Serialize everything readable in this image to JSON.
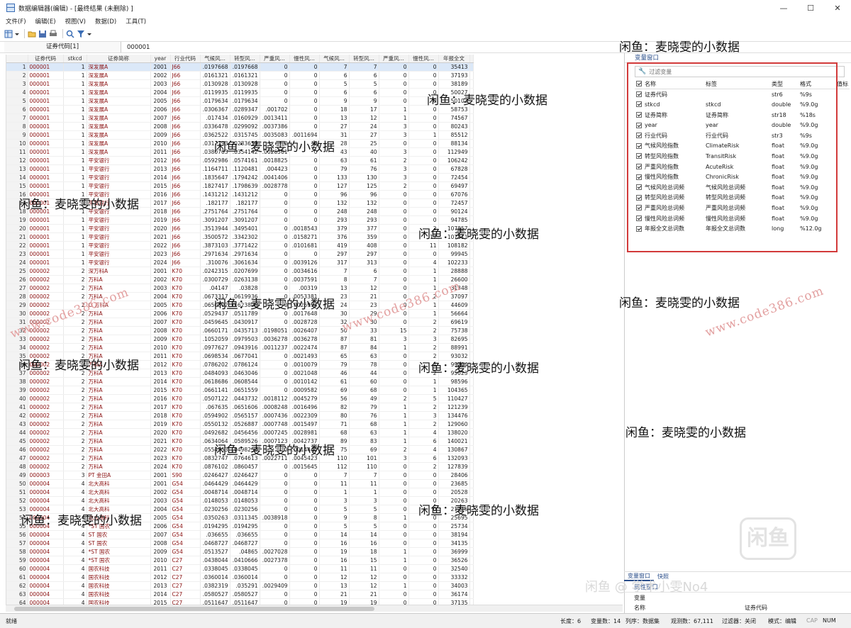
{
  "window": {
    "title": "数据编辑器(编辑) - [最终结果 (未删除) ]",
    "controls": [
      "—",
      "☐",
      "✕"
    ]
  },
  "menu": [
    "文件(F)",
    "编辑(E)",
    "视图(V)",
    "数据(D)",
    "工具(T)"
  ],
  "cmdbar": {
    "var_label": "证券代码[1]",
    "value": "000001"
  },
  "columns": [
    "证券代码",
    "stkcd",
    "证券简称",
    "year",
    "行业代码",
    "气候风...",
    "转型风...",
    "严重风...",
    "慢性风...",
    "气候风...",
    "转型风...",
    "严重风...",
    "慢性风...",
    "年报全文"
  ],
  "rows": [
    [
      "000001",
      "1",
      "深发展A",
      "2001",
      "J66",
      ".0197668",
      ".0197668",
      "0",
      "0",
      "7",
      "7",
      "0",
      "0",
      "35413"
    ],
    [
      "000001",
      "1",
      "深发展A",
      "2002",
      "J66",
      ".0161321",
      ".0161321",
      "0",
      "0",
      "6",
      "6",
      "0",
      "0",
      "37193"
    ],
    [
      "000001",
      "1",
      "深发展A",
      "2003",
      "J66",
      ".0130928",
      ".0130928",
      "0",
      "0",
      "5",
      "5",
      "0",
      "0",
      "38189"
    ],
    [
      "000001",
      "1",
      "深发展A",
      "2004",
      "J66",
      ".0119935",
      ".0119935",
      "0",
      "0",
      "6",
      "6",
      "0",
      "0",
      "50027"
    ],
    [
      "000001",
      "1",
      "深发展A",
      "2005",
      "J66",
      ".0179634",
      ".0179634",
      "0",
      "0",
      "9",
      "9",
      "0",
      "0",
      "50102"
    ],
    [
      "000001",
      "1",
      "深发展A",
      "2006",
      "J66",
      ".0306367",
      ".0289347",
      ".001702",
      "0",
      "18",
      "17",
      "1",
      "0",
      "58753"
    ],
    [
      "000001",
      "1",
      "深发展A",
      "2007",
      "J66",
      ".017434",
      ".0160929",
      ".0013411",
      "0",
      "13",
      "12",
      "1",
      "0",
      "74567"
    ],
    [
      "000001",
      "1",
      "深发展A",
      "2008",
      "J66",
      ".0336478",
      ".0299092",
      ".0037386",
      "0",
      "27",
      "24",
      "3",
      "0",
      "80243"
    ],
    [
      "000001",
      "1",
      "深发展A",
      "2009",
      "J66",
      ".0362522",
      ".0315745",
      ".0035083",
      ".0011694",
      "31",
      "27",
      "3",
      "1",
      "85512"
    ],
    [
      "000001",
      "1",
      "深发展A",
      "2010",
      "J66",
      ".0317793",
      ".0283659",
      "0",
      "0",
      "28",
      "25",
      "0",
      "0",
      "88134"
    ],
    [
      "000001",
      "1",
      "深发展A",
      "2011",
      "J66",
      ".0380703",
      ".0354142",
      ".0026561",
      "0",
      "43",
      "40",
      "3",
      "0",
      "112949"
    ],
    [
      "000001",
      "1",
      "平安银行",
      "2012",
      "J66",
      ".0592986",
      ".0574161",
      ".0018825",
      "0",
      "63",
      "61",
      "2",
      "0",
      "106242"
    ],
    [
      "000001",
      "1",
      "平安银行",
      "2013",
      "J66",
      ".1164711",
      ".1120481",
      ".004423",
      "0",
      "79",
      "76",
      "3",
      "0",
      "67828"
    ],
    [
      "000001",
      "1",
      "平安银行",
      "2014",
      "J66",
      ".1835647",
      ".1794242",
      ".0041406",
      "0",
      "133",
      "130",
      "3",
      "0",
      "72454"
    ],
    [
      "000001",
      "1",
      "平安银行",
      "2015",
      "J66",
      ".1827417",
      ".1798639",
      ".0028778",
      "0",
      "127",
      "125",
      "2",
      "0",
      "69497"
    ],
    [
      "000001",
      "1",
      "平安银行",
      "2016",
      "J66",
      ".1431212",
      ".1431212",
      "0",
      "0",
      "96",
      "96",
      "0",
      "0",
      "67076"
    ],
    [
      "000001",
      "1",
      "平安银行",
      "2017",
      "J66",
      ".182177",
      ".182177",
      "0",
      "0",
      "132",
      "132",
      "0",
      "0",
      "72457"
    ],
    [
      "000001",
      "1",
      "平安银行",
      "2018",
      "J66",
      ".2751764",
      ".2751764",
      "0",
      "0",
      "248",
      "248",
      "0",
      "0",
      "90124"
    ],
    [
      "000001",
      "1",
      "平安银行",
      "2019",
      "J66",
      ".3091207",
      ".3091207",
      "0",
      "0",
      "293",
      "293",
      "0",
      "0",
      "94785"
    ],
    [
      "000001",
      "1",
      "平安银行",
      "2020",
      "J66",
      ".3513944",
      ".3495401",
      "0",
      ".0018543",
      "379",
      "377",
      "0",
      "2",
      "107857"
    ],
    [
      "000001",
      "1",
      "平安银行",
      "2021",
      "J66",
      ".3500572",
      ".3342302",
      "0",
      ".0158271",
      "376",
      "359",
      "0",
      "17",
      "107411"
    ],
    [
      "000001",
      "1",
      "平安银行",
      "2022",
      "J66",
      ".3873103",
      ".3771422",
      "0",
      ".0101681",
      "419",
      "408",
      "0",
      "11",
      "108182"
    ],
    [
      "000001",
      "1",
      "平安银行",
      "2023",
      "J66",
      ".2971634",
      ".2971634",
      "0",
      "0",
      "297",
      "297",
      "0",
      "0",
      "99945"
    ],
    [
      "000001",
      "1",
      "平安银行",
      "2024",
      "J66",
      ".310076",
      ".3061634",
      "0",
      ".0039126",
      "317",
      "313",
      "0",
      "4",
      "102233"
    ],
    [
      "000002",
      "2",
      "深万科A",
      "2001",
      "K70",
      ".0242315",
      ".0207699",
      "0",
      ".0034616",
      "7",
      "6",
      "0",
      "1",
      "28888"
    ],
    [
      "000002",
      "2",
      "万科A",
      "2002",
      "K70",
      ".0300729",
      ".0263138",
      "0",
      ".0037591",
      "8",
      "7",
      "0",
      "1",
      "26600"
    ],
    [
      "000002",
      "2",
      "万科A",
      "2003",
      "K70",
      ".04147",
      ".03828",
      "0",
      ".00319",
      "13",
      "12",
      "0",
      "1",
      "31348"
    ],
    [
      "000002",
      "2",
      "万科A",
      "2004",
      "K70",
      ".0673317",
      ".0619936",
      "0",
      ".0053381",
      "23",
      "21",
      "0",
      "2",
      "37097"
    ],
    [
      "000002",
      "2",
      "G 万科A",
      "2005",
      "K70",
      ".0650802",
      "0.623808",
      "0",
      ".0026994",
      "24",
      "23",
      "0",
      "1",
      "44609"
    ],
    [
      "000002",
      "2",
      "万科A",
      "2006",
      "K70",
      ".0529437",
      ".0511789",
      "0",
      ".0017648",
      "30",
      "29",
      "0",
      "1",
      "56664"
    ],
    [
      "000002",
      "2",
      "万科A",
      "2007",
      "K70",
      ".0459645",
      ".0430917",
      "0",
      ".0028728",
      "32",
      "30",
      "0",
      "2",
      "69619"
    ],
    [
      "000002",
      "2",
      "万科A",
      "2008",
      "K70",
      ".0660171",
      ".0435713",
      ".0198051",
      ".0026407",
      "50",
      "33",
      "15",
      "2",
      "75738"
    ],
    [
      "000002",
      "2",
      "万科A",
      "2009",
      "K70",
      ".1052059",
      ".0979503",
      ".0036278",
      ".0036278",
      "87",
      "81",
      "3",
      "3",
      "82695"
    ],
    [
      "000002",
      "2",
      "万科A",
      "2010",
      "K70",
      ".0977627",
      ".0943916",
      ".0011237",
      ".0022474",
      "87",
      "84",
      "1",
      "2",
      "88991"
    ],
    [
      "000002",
      "2",
      "万科A",
      "2011",
      "K70",
      ".0698534",
      ".0677041",
      "0",
      ".0021493",
      "65",
      "63",
      "0",
      "2",
      "93032"
    ],
    [
      "000002",
      "2",
      "万科A",
      "2012",
      "K70",
      ".0786202",
      ".0786124",
      "0",
      ".0010079",
      "79",
      "78",
      "0",
      "1",
      "99204"
    ],
    [
      "000002",
      "2",
      "万科A",
      "2013",
      "K70",
      ".0484093",
      ".0463046",
      "0",
      ".0021048",
      "46",
      "44",
      "0",
      "2",
      "95023"
    ],
    [
      "000002",
      "2",
      "万科A",
      "2014",
      "K70",
      ".0618686",
      ".0608544",
      "0",
      ".0010142",
      "61",
      "60",
      "0",
      "1",
      "98596"
    ],
    [
      "000002",
      "2",
      "万科A",
      "2015",
      "K70",
      ".0661141",
      ".0651559",
      "0",
      ".0009582",
      "69",
      "68",
      "0",
      "1",
      "104365"
    ],
    [
      "000002",
      "2",
      "万科A",
      "2016",
      "K70",
      ".0507122",
      ".0443732",
      ".0018112",
      ".0045279",
      "56",
      "49",
      "2",
      "5",
      "110427"
    ],
    [
      "000002",
      "2",
      "万科A",
      "2017",
      "K70",
      ".067635",
      ".0651606",
      ".0008248",
      ".0016496",
      "82",
      "79",
      "1",
      "2",
      "121239"
    ],
    [
      "000002",
      "2",
      "万科A",
      "2018",
      "K70",
      ".0594902",
      ".0565157",
      ".0007436",
      ".0022309",
      "80",
      "76",
      "1",
      "3",
      "134476"
    ],
    [
      "000002",
      "2",
      "万科A",
      "2019",
      "K70",
      ".0550132",
      ".0526887",
      ".0007748",
      ".0015497",
      "71",
      "68",
      "1",
      "2",
      "129060"
    ],
    [
      "000002",
      "2",
      "万科A",
      "2020",
      "K70",
      ".0492682",
      ".0456456",
      ".0007245",
      ".0028981",
      "68",
      "63",
      "1",
      "4",
      "138020"
    ],
    [
      "000002",
      "2",
      "万科A",
      "2021",
      "K70",
      ".0634064",
      ".0589526",
      ".0007123",
      ".0042737",
      "89",
      "83",
      "1",
      "6",
      "140021"
    ],
    [
      "000002",
      "2",
      "万科A",
      "2022",
      "K70",
      ".0554553",
      ".0498253",
      "0",
      ".0014444",
      "75",
      "69",
      "2",
      "4",
      "130867"
    ],
    [
      "000002",
      "2",
      "万科A",
      "2023",
      "K70",
      ".0832747",
      ".0764613",
      ".0022711",
      ".0045423",
      "110",
      "101",
      "3",
      "6",
      "132093"
    ],
    [
      "000002",
      "2",
      "万科A",
      "2024",
      "K70",
      ".0876102",
      ".0860457",
      "0",
      ".0015645",
      "112",
      "110",
      "0",
      "2",
      "127839"
    ],
    [
      "000003",
      "3",
      "PT 金田A",
      "2001",
      "S90",
      ".0246427",
      ".0246427",
      "0",
      "0",
      "7",
      "7",
      "0",
      "0",
      "28406"
    ],
    [
      "000004",
      "4",
      "北大高科",
      "2001",
      "G54",
      ".0464429",
      ".0464429",
      "0",
      "0",
      "11",
      "11",
      "0",
      "0",
      "23685"
    ],
    [
      "000004",
      "4",
      "北大高科",
      "2002",
      "G54",
      ".0048714",
      ".0048714",
      "0",
      "0",
      "1",
      "1",
      "0",
      "0",
      "20528"
    ],
    [
      "000004",
      "4",
      "北大高科",
      "2003",
      "G54",
      ".0148053",
      ".0148053",
      "0",
      "0",
      "3",
      "3",
      "0",
      "0",
      "20263"
    ],
    [
      "000004",
      "4",
      "北大高科",
      "2004",
      "G54",
      ".0230256",
      ".0230256",
      "0",
      "0",
      "5",
      "5",
      "0",
      "0",
      "21715"
    ],
    [
      "000004",
      "4",
      "北大高科",
      "2005",
      "G54",
      ".0350263",
      ".0311345",
      ".0038918",
      "0",
      "9",
      "8",
      "1",
      "0",
      "25695"
    ],
    [
      "000004",
      "4",
      "*ST 国农",
      "2006",
      "G54",
      ".0194295",
      ".0194295",
      "0",
      "0",
      "5",
      "5",
      "0",
      "0",
      "25734"
    ],
    [
      "000004",
      "4",
      "ST 国农",
      "2007",
      "G54",
      ".036655",
      ".036655",
      "0",
      "0",
      "14",
      "14",
      "0",
      "0",
      "38194"
    ],
    [
      "000004",
      "4",
      "ST 国农",
      "2008",
      "G54",
      ".0468727",
      ".0468727",
      "0",
      "0",
      "16",
      "16",
      "0",
      "0",
      "34135"
    ],
    [
      "000004",
      "4",
      "*ST 国农",
      "2009",
      "G54",
      ".0513527",
      ".04865",
      ".0027028",
      "0",
      "19",
      "18",
      "1",
      "0",
      "36999"
    ],
    [
      "000004",
      "4",
      "*ST 国农",
      "2010",
      "C27",
      ".0438044",
      ".0410666",
      ".0027378",
      "0",
      "16",
      "15",
      "1",
      "0",
      "36526"
    ],
    [
      "000004",
      "4",
      "国农科技",
      "2011",
      "C27",
      ".0338045",
      ".0338045",
      "0",
      "0",
      "11",
      "11",
      "0",
      "0",
      "32540"
    ],
    [
      "000004",
      "4",
      "国农科技",
      "2012",
      "C27",
      ".0360014",
      ".0360014",
      "0",
      "0",
      "12",
      "12",
      "0",
      "0",
      "33332"
    ],
    [
      "000004",
      "4",
      "国农科技",
      "2013",
      "C27",
      ".0382319",
      ".035291",
      ".0029409",
      "0",
      "13",
      "12",
      "1",
      "0",
      "34003"
    ],
    [
      "000004",
      "4",
      "国农科技",
      "2014",
      "C27",
      ".0580527",
      ".0580527",
      "0",
      "0",
      "21",
      "21",
      "0",
      "0",
      "36174"
    ],
    [
      "000004",
      "4",
      "国农科技",
      "2015",
      "C27",
      ".0511647",
      ".0511647",
      "0",
      "0",
      "19",
      "19",
      "0",
      "0",
      "37135"
    ]
  ],
  "var_panel": {
    "title": "变量窗口",
    "filter_placeholder": "过滤变量",
    "headers": [
      "名称",
      "标签",
      "类型",
      "格式",
      "值标"
    ],
    "vars": [
      [
        "证券代码",
        "",
        "str6",
        "%9s"
      ],
      [
        "stkcd",
        "stkcd",
        "double",
        "%9.0g"
      ],
      [
        "证券简称",
        "证券简称",
        "str18",
        "%18s"
      ],
      [
        "year",
        "year",
        "double",
        "%9.0g"
      ],
      [
        "行业代码",
        "行业代码",
        "str3",
        "%9s"
      ],
      [
        "气候风险指数",
        "ClimateRisk",
        "float",
        "%9.0g"
      ],
      [
        "转型风险指数",
        "TransitRisk",
        "float",
        "%9.0g"
      ],
      [
        "严重风险指数",
        "AcuteRisk",
        "float",
        "%9.0g"
      ],
      [
        "慢性风险指数",
        "ChronicRisk",
        "float",
        "%9.0g"
      ],
      [
        "气候风险总词频",
        "气候风险总词频",
        "float",
        "%9.0g"
      ],
      [
        "转型风险总词频",
        "转型风险总词频",
        "float",
        "%9.0g"
      ],
      [
        "严重风险总词频",
        "严重风险总词频",
        "float",
        "%9.0g"
      ],
      [
        "慢性风险总词频",
        "慢性风险总词频",
        "float",
        "%9.0g"
      ],
      [
        "年报全文总词数",
        "年报全文总词数",
        "long",
        "%12.0g"
      ]
    ]
  },
  "tabs": [
    "变量窗口",
    "快照"
  ],
  "prop_panel": {
    "title": "属性窗口",
    "section": "变量",
    "row_label": "名称",
    "row_value": "证券代码"
  },
  "status": {
    "ready": "就绪",
    "length": "长度：6",
    "vars": "变量数：14",
    "order": "列序：数据集",
    "obs": "观测数：67,111",
    "filter": "过滤器：关闭",
    "mode": "模式：编辑",
    "caps": "CAP",
    "num": "NUM"
  },
  "watermarks": {
    "text": "闲鱼：麦晓雯的小数据",
    "url": "www.code386.com",
    "bottom": "闲鱼 @ 学术小雯No4",
    "stamp": "闲鱼"
  }
}
